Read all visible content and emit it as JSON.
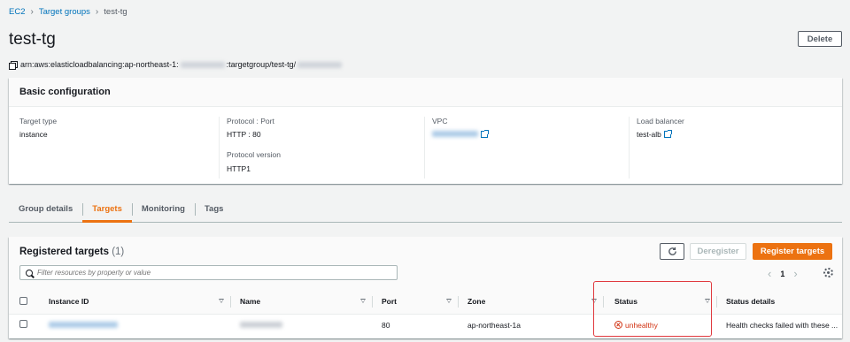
{
  "breadcrumb": {
    "root": "EC2",
    "parent": "Target groups",
    "current": "test-tg"
  },
  "title": "test-tg",
  "delete_label": "Delete",
  "arn": {
    "prefix": "arn:aws:elasticloadbalancing:ap-northeast-1:",
    "middle": ":targetgroup/test-tg/"
  },
  "basic": {
    "title": "Basic configuration",
    "target_type_label": "Target type",
    "target_type": "instance",
    "protocol_port_label": "Protocol : Port",
    "protocol_port": "HTTP : 80",
    "protocol_version_label": "Protocol version",
    "protocol_version": "HTTP1",
    "vpc_label": "VPC",
    "lb_label": "Load balancer",
    "lb_value": "test-alb"
  },
  "tabs": [
    "Group details",
    "Targets",
    "Monitoring",
    "Tags"
  ],
  "active_tab": "Targets",
  "targets": {
    "title": "Registered targets",
    "count": "(1)",
    "deregister_label": "Deregister",
    "register_label": "Register targets",
    "filter_placeholder": "Filter resources by property or value",
    "page": "1",
    "columns": [
      "Instance ID",
      "Name",
      "Port",
      "Zone",
      "Status",
      "Status details"
    ],
    "rows": [
      {
        "port": "80",
        "zone": "ap-northeast-1a",
        "status": "unhealthy",
        "status_details": "Health checks failed with these ..."
      }
    ]
  },
  "colors": {
    "accent": "#ec7211",
    "link": "#0073bb",
    "error": "#d13212",
    "highlight": "#e0393e"
  }
}
